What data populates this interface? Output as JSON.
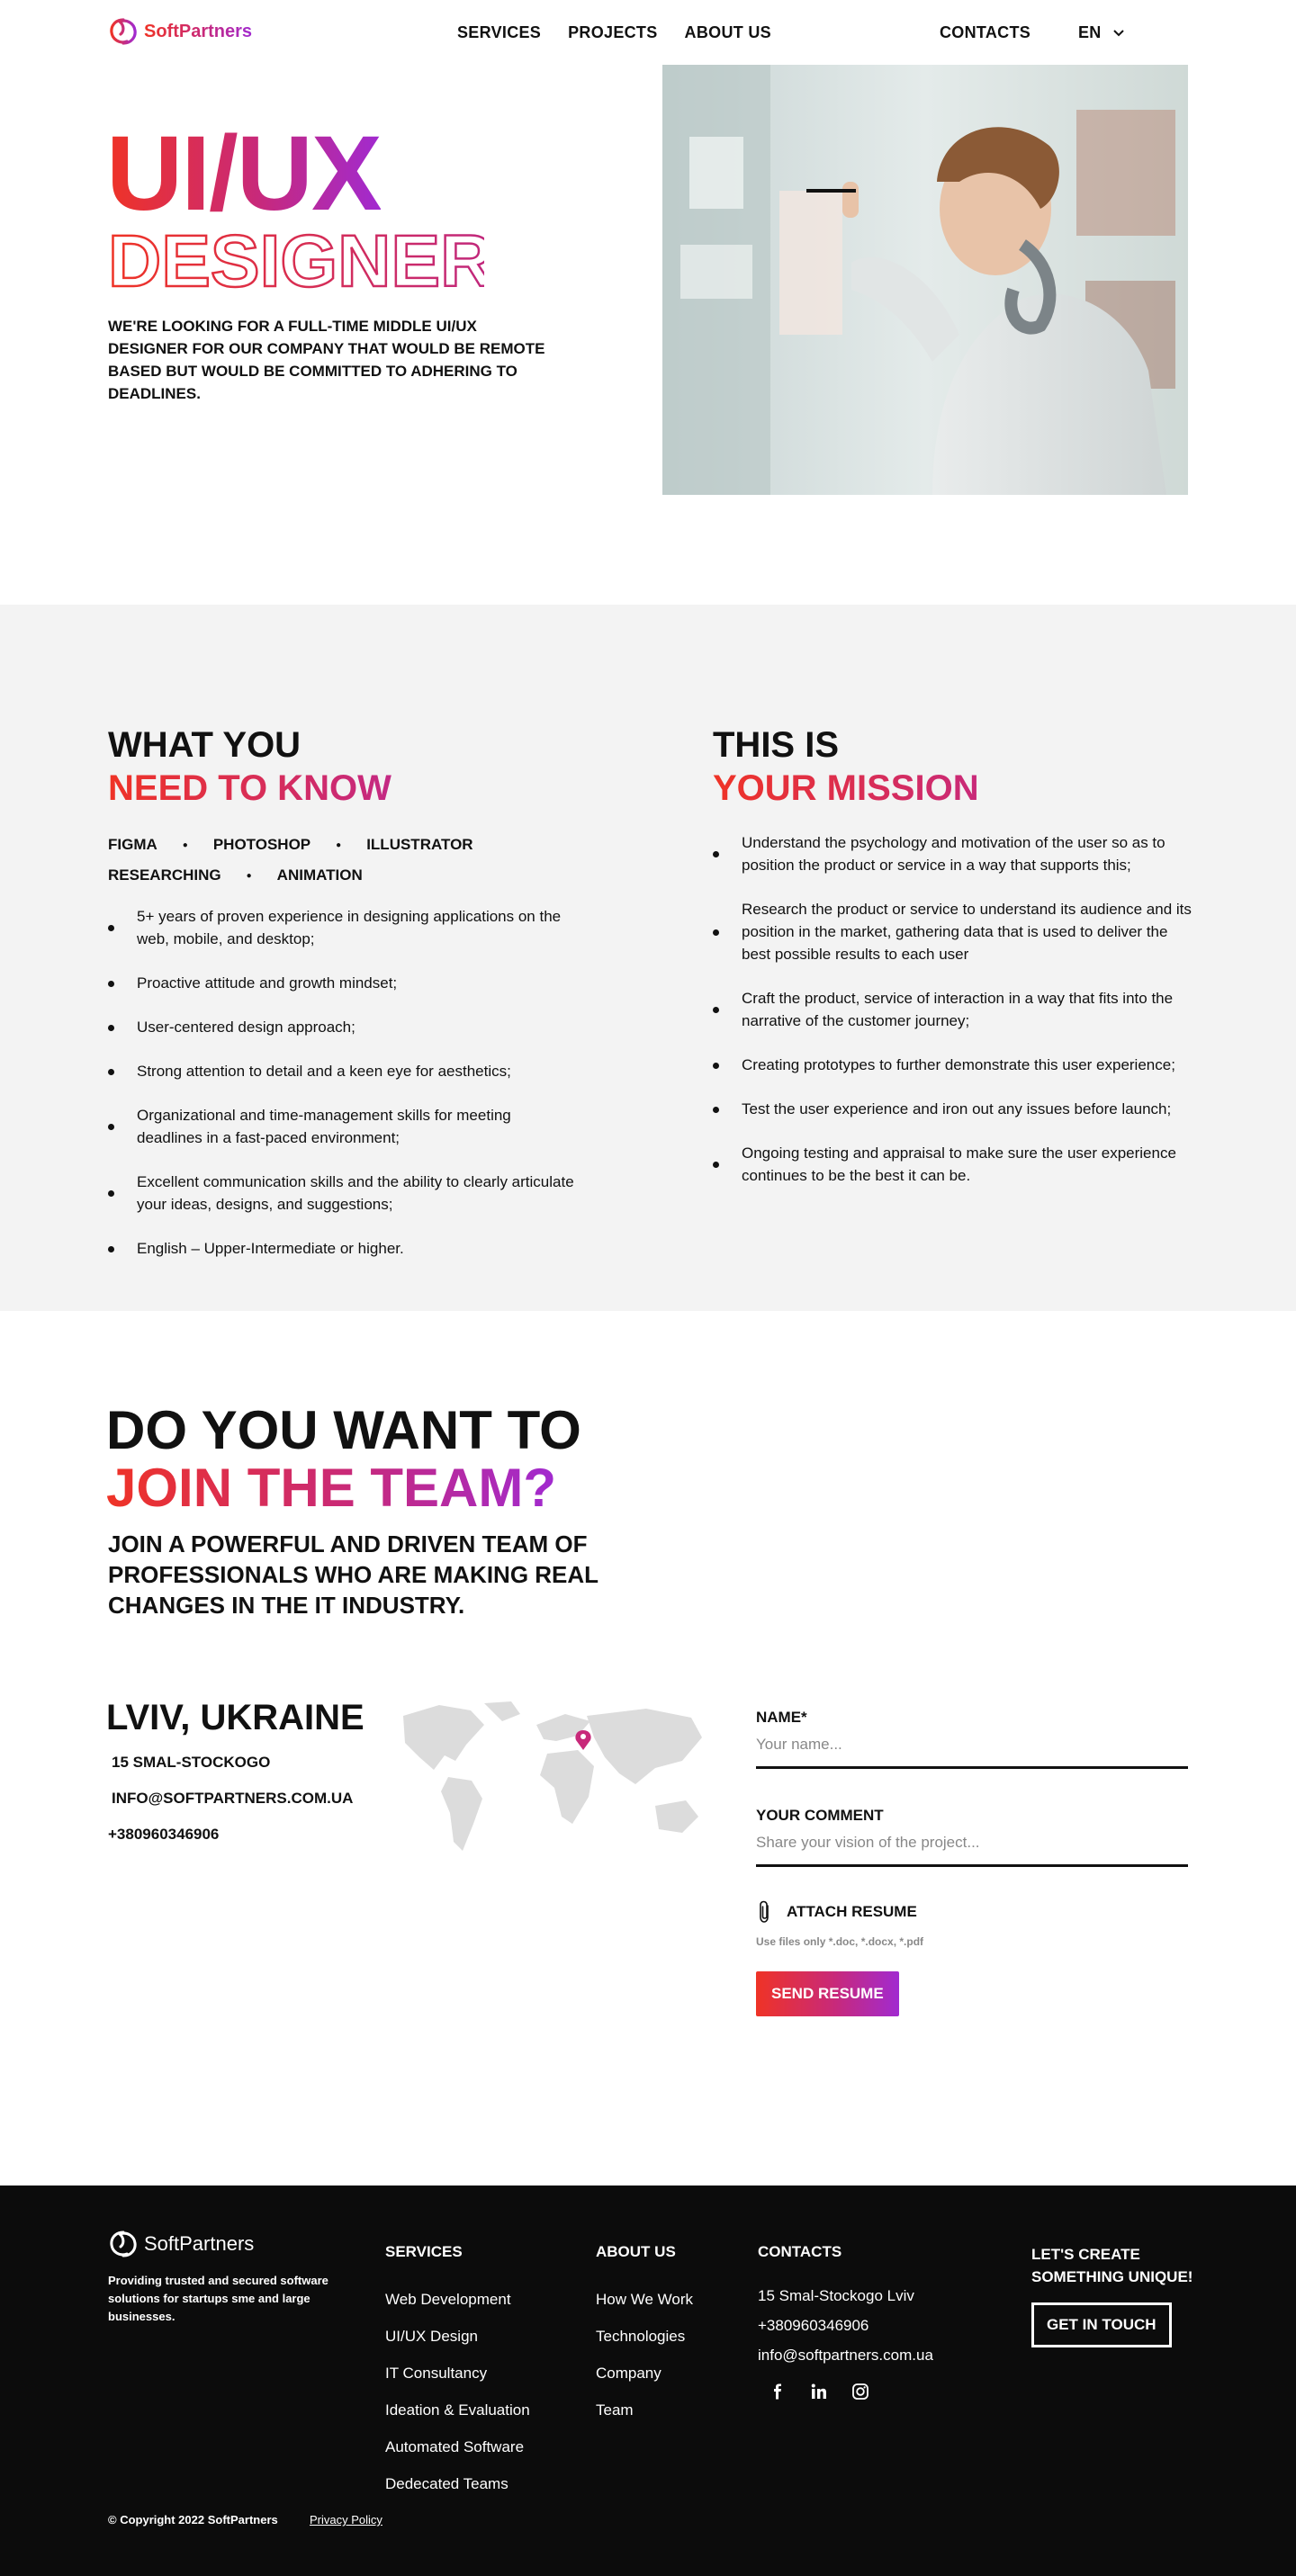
{
  "header": {
    "logo_text": "SoftPartners",
    "nav": [
      "SERVICES",
      "PROJECTS",
      "ABOUT US"
    ],
    "contacts": "CONTACTS",
    "lang": "EN",
    "lang_icon": "chevron-down-icon"
  },
  "hero": {
    "title_line1": "UI/UX",
    "title_line2": "DESIGNER",
    "description": "We're looking for a full-time middle UI/UX designer for our company that would be remote based but would be committed to adhering to deadlines."
  },
  "requirements": {
    "title_line1": "WHAT YOU",
    "title_line2": "NEED TO KNOW",
    "skills_row1": [
      "FIGMA",
      "PHOTOSHOP",
      "ILLUSTRATOR"
    ],
    "skills_row2": [
      "RESEARCHING",
      "ANIMATION"
    ],
    "items": [
      "5+ years of proven experience in designing applications on the web, mobile, and desktop;",
      "Proactive attitude and growth mindset;",
      "User-centered design approach;",
      "Strong attention to detail and a keen eye for aesthetics;",
      "Organizational and time-management skills for meeting deadlines in a fast-paced environment;",
      "Excellent communication skills and the ability to clearly articulate your ideas, designs, and suggestions;",
      "English – Upper-Intermediate or higher."
    ]
  },
  "mission": {
    "title_line1": "THIS IS",
    "title_line2": "YOUR MISSION",
    "items": [
      "Understand the psychology and motivation of the user so as to position the product or service in a way that supports this;",
      "Research the product or service to understand its audience and its position in the market, gathering data that is used to deliver the best possible results to each user",
      "Craft the product, service of  interaction in a way that fits into the narrative of the customer journey;",
      "Creating prototypes to further demonstrate this user experience;",
      "Test the user experience and iron out any issues before launch;",
      "Ongoing testing and appraisal to make sure the user experience continues to be the best it can be."
    ]
  },
  "join": {
    "title_line1": "DO YOU WANT TO",
    "title_line2": "JOIN THE TEAM?",
    "subtitle": "Join a powerful and driven team of professionals who are making real changes in the IT industry."
  },
  "contact": {
    "city": "LVIV, UKRAINE",
    "address": "15 SMAL-STOCKOGO",
    "email": "INFO@SOFTPARTNERS.COM.UA",
    "phone": "+380960346906",
    "map_icon": "map-pin-icon"
  },
  "form": {
    "name_label": "NAME*",
    "name_placeholder": "Your name...",
    "comment_label": "YOUR COMMENT",
    "comment_placeholder": "Share your vision of the project...",
    "attach_label": "ATTACH RESUME",
    "attach_icon": "paperclip-icon",
    "hint": "Use files only *.doc, *.docx, *.pdf",
    "send_label": "SEND RESUME"
  },
  "footer": {
    "logo_text": "SoftPartners",
    "tagline": "Providing trusted and secured software solutions for startups sme and large businesses.",
    "services_title": "SERVICES",
    "services": [
      "Web Development",
      "UI/UX Design",
      "IT Consultancy",
      "Ideation & Evaluation",
      "Automated Software",
      "Dedecated Teams"
    ],
    "about_title": "ABOUT US",
    "about": [
      "How We Work",
      "Technologies",
      "Company",
      "Team"
    ],
    "contacts_title": "CONTACTS",
    "address": "15 Smal-Stockogo Lviv",
    "phone": "+380960346906",
    "email": "info@softpartners.com.ua",
    "social_icons": [
      "facebook-icon",
      "linkedin-icon",
      "instagram-icon"
    ],
    "cta_title": "LET'S CREATE SOMETHING UNIQUE!",
    "cta_button": "GET IN TOUCH",
    "copyright": "© Copyright 2022 SoftPartners",
    "privacy": "Privacy Policy"
  },
  "colors": {
    "gradient_start": "#ef3326",
    "gradient_mid": "#c8297a",
    "gradient_end": "#a12ad0",
    "section_bg": "#f3f3f3",
    "footer_bg": "#0c0c0c"
  }
}
